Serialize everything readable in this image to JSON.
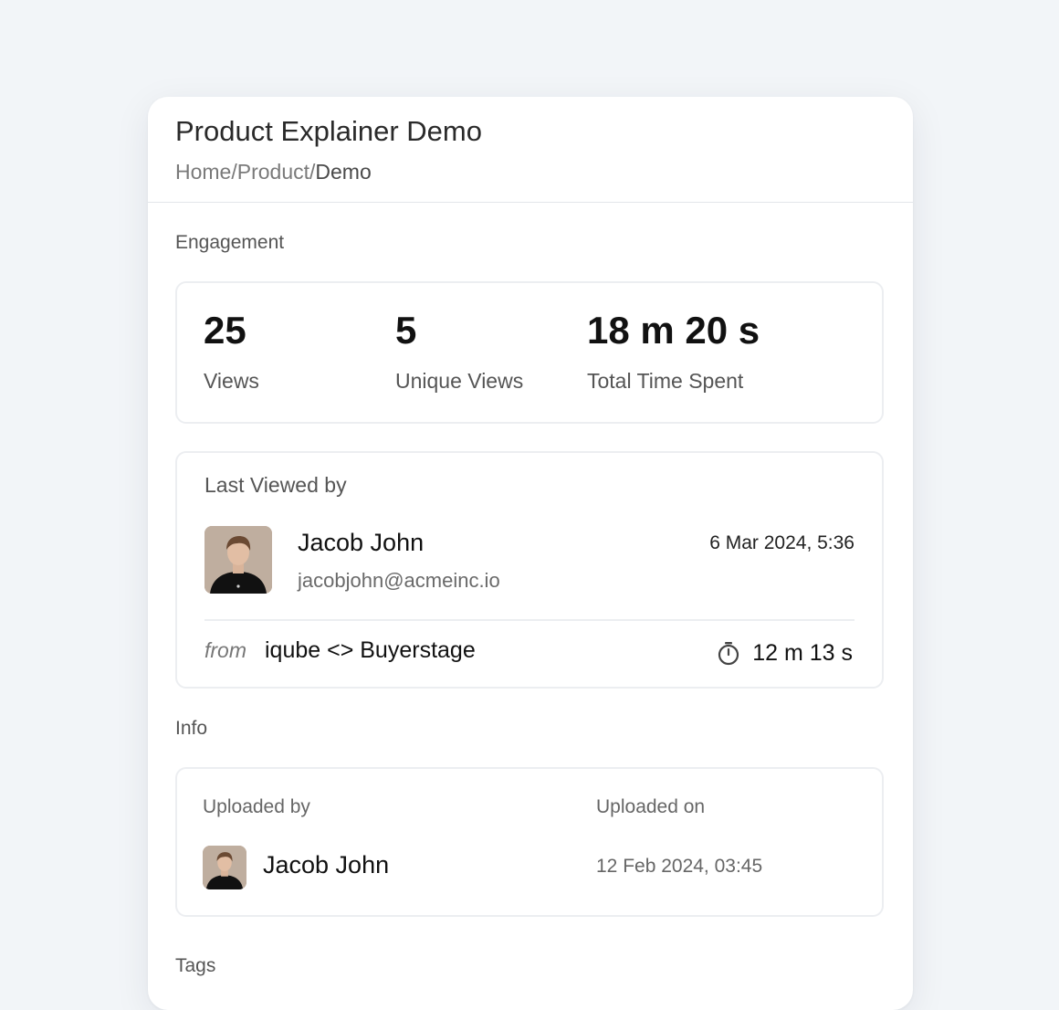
{
  "header": {
    "title": "Product Explainer Demo",
    "breadcrumb": {
      "home": "Home",
      "sep1": "/",
      "product": "Product",
      "sep2": "/",
      "current": "Demo"
    }
  },
  "engagement": {
    "section_label": "Engagement",
    "stats": [
      {
        "value": "25",
        "label": "Views"
      },
      {
        "value": "5",
        "label": "Unique Views"
      },
      {
        "value": "18 m 20 s",
        "label": "Total Time Spent"
      }
    ]
  },
  "last_viewed": {
    "heading": "Last Viewed by",
    "name": "Jacob John",
    "email": "jacobjohn@acmeinc.io",
    "viewed_at": "6 Mar 2024, 5:36",
    "from_label": "from",
    "from_room": "iqube <> Buyerstage",
    "duration": "12 m 13 s",
    "icon": "stopwatch-icon"
  },
  "info": {
    "section_label": "Info",
    "uploaded_by_label": "Uploaded by",
    "uploaded_on_label": "Uploaded on",
    "uploader_name": "Jacob John",
    "uploaded_on": "12 Feb 2024, 03:45"
  },
  "tags": {
    "section_label": "Tags"
  }
}
